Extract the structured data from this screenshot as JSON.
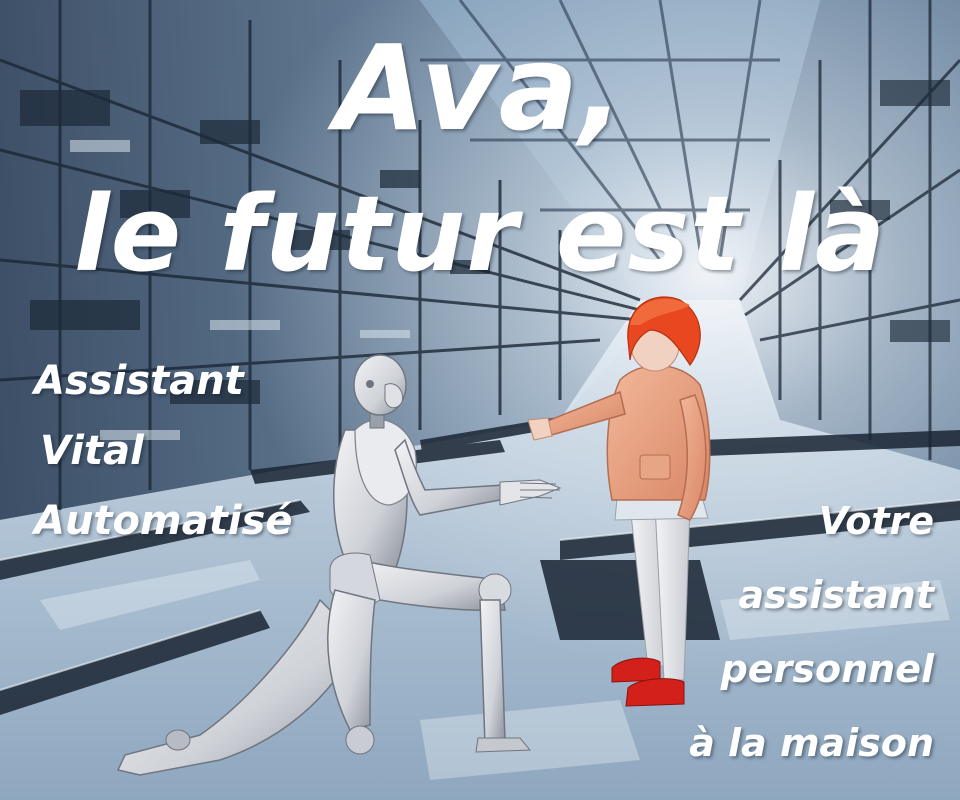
{
  "poster": {
    "title_line1": "Ava,",
    "title_line2": "le futur est là",
    "acronym": [
      "Assistant",
      "Vital",
      "Automatisé"
    ],
    "tagline": [
      "Votre",
      "assistant",
      "personnel",
      "à la maison"
    ]
  },
  "scene": {
    "background": "futuristic-glass-corridor",
    "figures": [
      "humanoid-robot-kneeling",
      "girl-red-hair"
    ]
  },
  "colors": {
    "text": "#ffffff",
    "sky": "#e9eef4",
    "steel_blue": "#4c6b8c",
    "dark_blue": "#1f2c3c",
    "robot_silver": "#d9dbe0",
    "hair_red": "#e8471f",
    "jacket_pink": "#e8a07d",
    "shoe_red": "#d3201b"
  }
}
